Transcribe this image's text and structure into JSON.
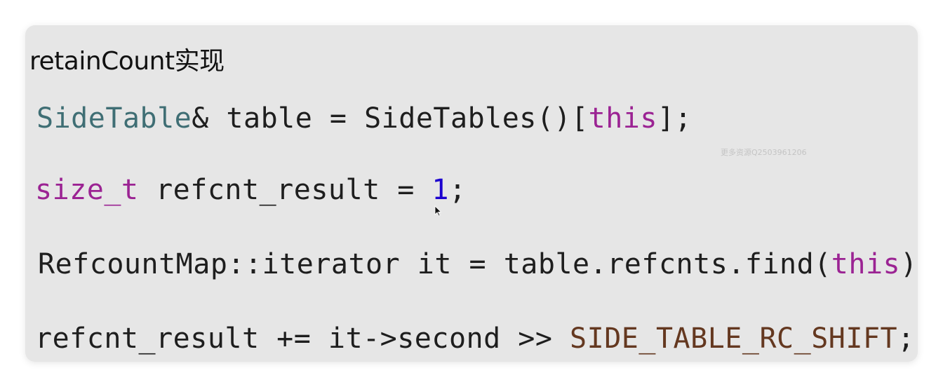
{
  "title": "retainCount实现",
  "watermark": "更多资源Q2503961206",
  "code": {
    "line1": {
      "type": "SideTable",
      "rest1": "& table = SideTables()[",
      "kw": "this",
      "rest2": "];"
    },
    "line2": {
      "type": "size_t",
      "rest1": " refcnt_result = ",
      "num": "1",
      "rest2": ";"
    },
    "line3": {
      "rest1": "RefcountMap::iterator it = table.refcnts.find(",
      "kw": "this",
      "rest2": ");"
    },
    "line4": {
      "rest1": "refcnt_result += it->second >> ",
      "const": "SIDE_TABLE_RC_SHIFT",
      "rest2": ";"
    }
  },
  "colors": {
    "type": "#3f6e74",
    "keyword": "#9b2393",
    "number": "#1c00cf",
    "constant": "#643820",
    "background": "#e6e6e6"
  },
  "icons": {
    "cursor": "mouse-pointer-icon"
  }
}
